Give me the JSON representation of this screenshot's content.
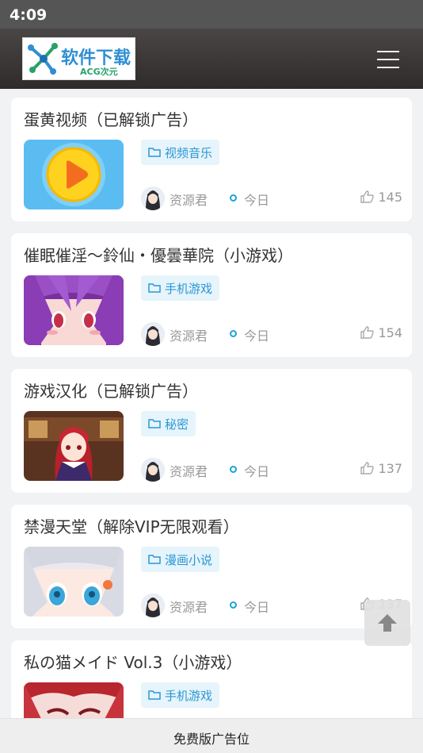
{
  "status_bar": {
    "time": "4:09"
  },
  "header": {
    "logo_text": "软件下载",
    "logo_sub": "ACG次元",
    "menu_icon": "hamburger-menu-icon"
  },
  "posts": [
    {
      "title": "蛋黄视频（已解锁广告）",
      "category": "视频音乐",
      "author": "资源君",
      "date": "今日",
      "likes": "145",
      "thumb": "egg-yolk-play-logo"
    },
    {
      "title": "催眠催淫～鈴仙・優曇華院（小游戏）",
      "category": "手机游戏",
      "author": "资源君",
      "date": "今日",
      "likes": "154",
      "thumb": "purple-hair-anime-girl"
    },
    {
      "title": "游戏汉化（已解锁广告）",
      "category": "秘密",
      "author": "资源君",
      "date": "今日",
      "likes": "137",
      "thumb": "red-hair-schoolgirl-classroom"
    },
    {
      "title": "禁漫天堂（解除VIP无限观看）",
      "category": "漫画小说",
      "author": "资源君",
      "date": "今日",
      "likes": "137",
      "thumb": "white-hair-anime-girl"
    },
    {
      "title": "私の猫メイド Vol.3（小游戏）",
      "category": "手机游戏",
      "author": "资源君",
      "date": "今日",
      "likes": "",
      "thumb": "red-hair-anime-girl"
    }
  ],
  "back_to_top": {
    "icon": "arrow-up-icon"
  },
  "ad_bar": {
    "label": "免费版广告位"
  },
  "colors": {
    "header": "#3a3636",
    "accent": "#2b97d6",
    "tag_bg": "#e6f4fb",
    "page_bg": "#f1f2f4"
  }
}
